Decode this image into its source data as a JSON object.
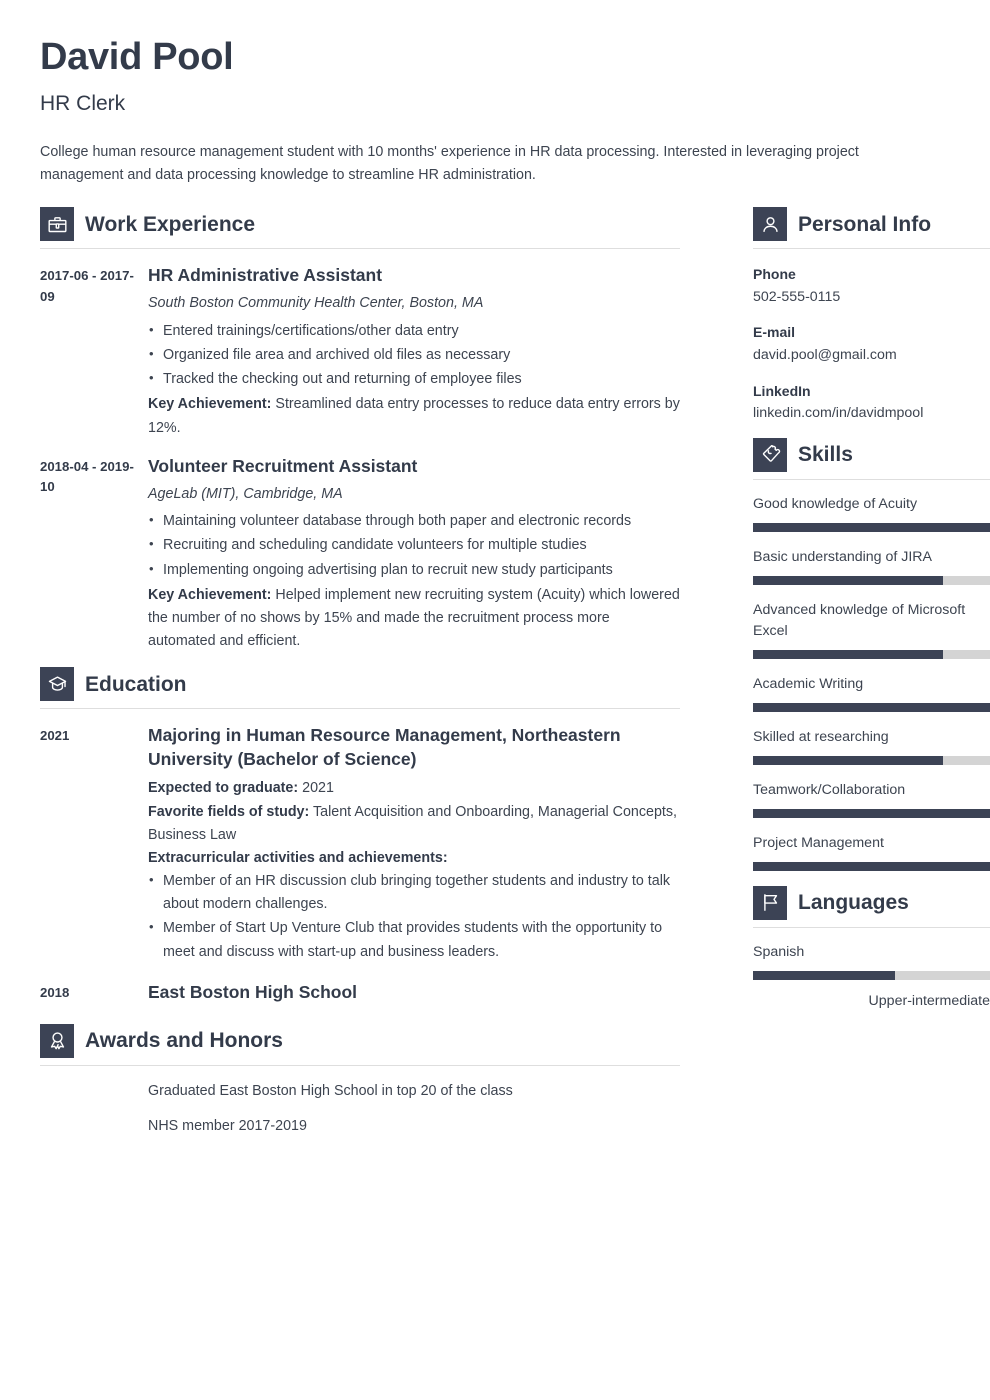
{
  "header": {
    "name": "David Pool",
    "job_title": "HR Clerk",
    "summary": "College human resource management student with 10 months' experience in HR data processing. Interested in leveraging project management and data processing knowledge to streamline HR administration."
  },
  "sections": {
    "work": {
      "title": "Work Experience",
      "icon": "briefcase-icon",
      "entries": [
        {
          "date": "2017-06 - 2017-09",
          "title": "HR Administrative Assistant",
          "subtitle": "South Boston Community Health Center, Boston, MA",
          "bullets": [
            "Entered trainings/certifications/other data entry",
            "Organized file area and archived old files as necessary",
            "Tracked the checking out and returning of employee files"
          ],
          "achievement_label": "Key Achievement:",
          "achievement_text": " Streamlined data entry processes to reduce data entry errors by 12%."
        },
        {
          "date": "2018-04 - 2019-10",
          "title": "Volunteer Recruitment Assistant",
          "subtitle": "AgeLab (MIT), Cambridge, MA",
          "bullets": [
            "Maintaining volunteer database through both paper and electronic records",
            "Recruiting and scheduling candidate volunteers for multiple studies",
            "Implementing ongoing advertising plan to recruit new study participants"
          ],
          "achievement_label": "Key Achievement:",
          "achievement_text": " Helped implement new recruiting system (Acuity) which lowered the number of no shows by 15% and made the recruitment process more automated and efficient."
        }
      ]
    },
    "education": {
      "title": "Education",
      "icon": "graduation-cap-icon",
      "entries": [
        {
          "date": "2021",
          "title": "Majoring in Human Resource Management, Northeastern University (Bachelor of Science)",
          "graduate_label": "Expected to graduate:",
          "graduate_value": " 2021",
          "fields_label": "Favorite fields of study:",
          "fields_value": " Talent Acquisition and Onboarding, Managerial Concepts, Business Law",
          "extra_label": "Extracurricular activities and achievements:",
          "bullets": [
            "Member of an HR discussion club bringing together students and industry to talk about modern challenges.",
            "Member of Start Up Venture Club that provides students with the opportunity to meet and discuss with start-up and business leaders."
          ]
        },
        {
          "date": "2018",
          "title": "East Boston High School"
        }
      ]
    },
    "awards": {
      "title": "Awards and Honors",
      "icon": "award-ribbon-icon",
      "items": [
        "Graduated East Boston High School in top 20 of the class",
        "NHS member 2017-2019"
      ]
    },
    "personal_info": {
      "title": "Personal Info",
      "icon": "person-icon",
      "contacts": [
        {
          "label": "Phone",
          "value": "502-555-0115"
        },
        {
          "label": "E-mail",
          "value": "david.pool@gmail.com"
        },
        {
          "label": "LinkedIn",
          "value": "linkedin.com/in/davidmpool"
        }
      ]
    },
    "skills": {
      "title": "Skills",
      "icon": "puzzle-piece-icon",
      "items": [
        {
          "label": "Good knowledge of Acuity",
          "level": 100
        },
        {
          "label": "Basic understanding of JIRA",
          "level": 80
        },
        {
          "label": "Advanced knowledge of Microsoft Excel",
          "level": 80
        },
        {
          "label": "Academic Writing",
          "level": 100
        },
        {
          "label": "Skilled at researching",
          "level": 80
        },
        {
          "label": "Teamwork/Collaboration",
          "level": 100
        },
        {
          "label": "Project Management",
          "level": 100
        }
      ]
    },
    "languages": {
      "title": "Languages",
      "icon": "flag-icon",
      "items": [
        {
          "label": "Spanish",
          "level": 60,
          "level_label": "Upper-intermediate"
        }
      ]
    }
  },
  "colors": {
    "accent_dark": "#3c4355",
    "text": "#333b4a",
    "bar_track": "#d4d4d4",
    "rule": "#dedede"
  }
}
